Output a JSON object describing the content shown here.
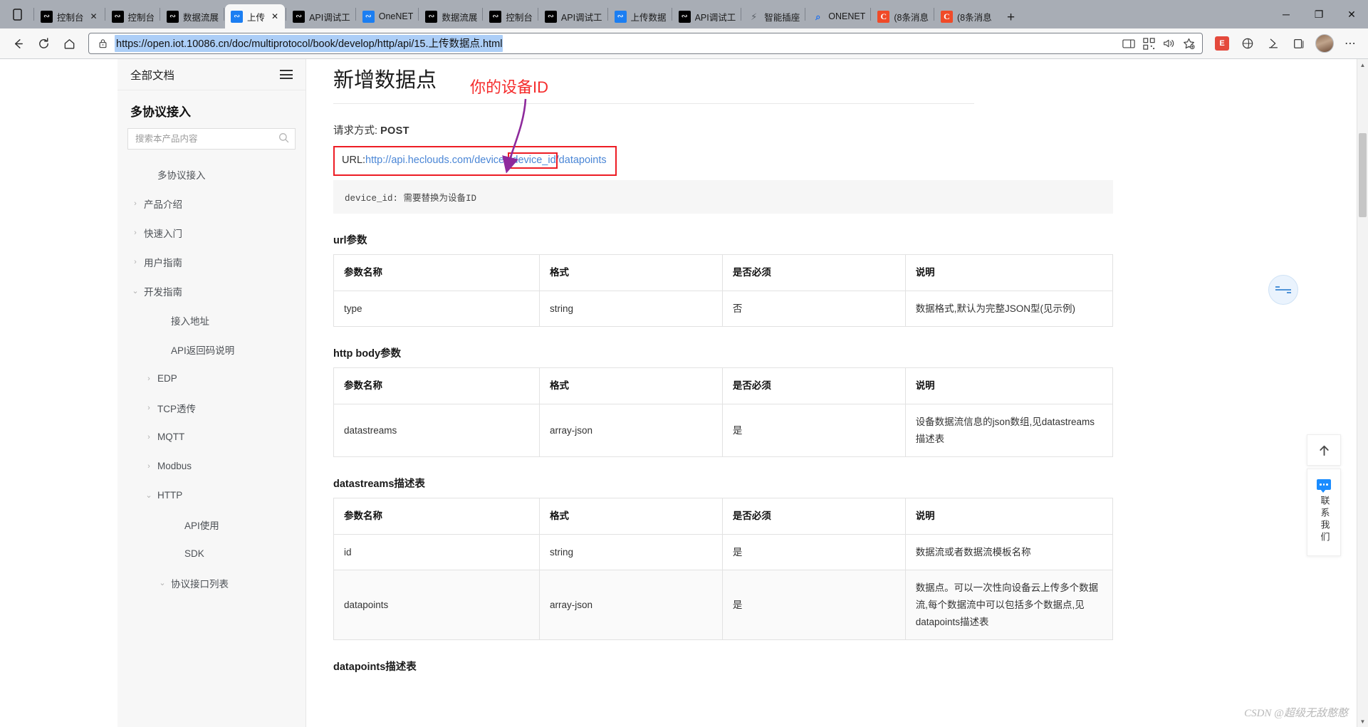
{
  "browser": {
    "tabs": [
      {
        "title": "控制台",
        "favicon": "onenet-icon",
        "active": false,
        "closable": true
      },
      {
        "title": "控制台",
        "favicon": "onenet-icon",
        "active": false,
        "closable": false
      },
      {
        "title": "数据流展",
        "favicon": "onenet-icon",
        "active": false,
        "closable": false
      },
      {
        "title": "上传",
        "favicon": "onenet-blue-icon",
        "active": true,
        "closable": true
      },
      {
        "title": "API调试工",
        "favicon": "onenet-icon",
        "active": false,
        "closable": false
      },
      {
        "title": "OneNET",
        "favicon": "onenet-blue-icon",
        "active": false,
        "closable": false
      },
      {
        "title": "数据流展",
        "favicon": "onenet-icon",
        "active": false,
        "closable": false
      },
      {
        "title": "控制台",
        "favicon": "onenet-icon",
        "active": false,
        "closable": false
      },
      {
        "title": "API调试工",
        "favicon": "onenet-icon",
        "active": false,
        "closable": false
      },
      {
        "title": "上传数据",
        "favicon": "onenet-blue-icon",
        "active": false,
        "closable": false
      },
      {
        "title": "API调试工",
        "favicon": "onenet-icon",
        "active": false,
        "closable": false
      },
      {
        "title": "智能插座",
        "favicon": "plug-icon",
        "active": false,
        "closable": false
      },
      {
        "title": "ONENET",
        "favicon": "search-icon",
        "active": false,
        "closable": false
      },
      {
        "title": "(8条消息",
        "favicon": "csdn-icon",
        "active": false,
        "closable": false
      },
      {
        "title": "(8条消息",
        "favicon": "csdn-icon",
        "active": false,
        "closable": false
      }
    ],
    "new_tab_label": "+",
    "window_controls": {
      "minimize": "─",
      "maximize": "❐",
      "close": "✕"
    },
    "toolbar": {
      "back": "←",
      "reload": "↻",
      "home": "⌂",
      "lock_icon": "lock-icon",
      "url": "https://open.iot.10086.cn/doc/multiprotocol/book/develop/http/api/15.上传数据点.html",
      "split_screen": "split-screen-icon",
      "qr": "qr-code-icon",
      "read_aloud": "read-aloud-icon",
      "favorite": "star-icon",
      "extension": "E",
      "collections": "collections-icon",
      "favorites_bar": "favorites-icon",
      "settings": "⋯"
    }
  },
  "sidebar": {
    "all_docs_label": "全部文档",
    "menu_icon": "hamburger-icon",
    "product_title": "多协议接入",
    "search": {
      "placeholder": "搜索本产品内容",
      "value": "",
      "icon": "search-icon"
    },
    "items": [
      {
        "label": "多协议接入",
        "level": 2,
        "caret": ""
      },
      {
        "label": "产品介绍",
        "level": 1,
        "caret": "›"
      },
      {
        "label": "快速入门",
        "level": 1,
        "caret": "›"
      },
      {
        "label": "用户指南",
        "level": 1,
        "caret": "›"
      },
      {
        "label": "开发指南",
        "level": 1,
        "caret": "⌄"
      },
      {
        "label": "接入地址",
        "level": 3,
        "caret": ""
      },
      {
        "label": "API返回码说明",
        "level": 3,
        "caret": ""
      },
      {
        "label": "EDP",
        "level": 2,
        "caret": "›"
      },
      {
        "label": "TCP透传",
        "level": 2,
        "caret": "›"
      },
      {
        "label": "MQTT",
        "level": 2,
        "caret": "›"
      },
      {
        "label": "Modbus",
        "level": 2,
        "caret": "›"
      },
      {
        "label": "HTTP",
        "level": 2,
        "caret": "⌄"
      },
      {
        "label": "API使用",
        "level": 4,
        "caret": ""
      },
      {
        "label": "SDK",
        "level": 4,
        "caret": ""
      },
      {
        "label": "协议接口列表",
        "level": 3,
        "caret": "⌄"
      }
    ]
  },
  "doc": {
    "title": "新增数据点",
    "request_method_label": "请求方式:",
    "request_method_value": "POST",
    "url_prefix": "URL:",
    "url_base": "http://api.heclouds.com/devices",
    "url_param": "/device_id",
    "url_suffix": "/datapoints",
    "code_note": "device_id: 需要替换为设备ID",
    "annotation": "你的设备ID",
    "annotation_color": "#f52c2c",
    "highlight_color": "#ed1c24",
    "arrow_color": "#8e2a9c",
    "sections": [
      {
        "heading": "url参数",
        "columns": [
          "参数名称",
          "格式",
          "是否必须",
          "说明"
        ],
        "rows": [
          [
            "type",
            "string",
            "否",
            "数据格式,默认为完整JSON型(见示例)"
          ]
        ]
      },
      {
        "heading": "http body参数",
        "columns": [
          "参数名称",
          "格式",
          "是否必须",
          "说明"
        ],
        "rows": [
          [
            "datastreams",
            "array-json",
            "是",
            "设备数据流信息的json数组,见datastreams描述表"
          ]
        ]
      },
      {
        "heading": "datastreams描述表",
        "columns": [
          "参数名称",
          "格式",
          "是否必须",
          "说明"
        ],
        "rows": [
          [
            "id",
            "string",
            "是",
            "数据流或者数据流模板名称"
          ],
          [
            "datapoints",
            "array-json",
            "是",
            "数据点。可以一次性向设备云上传多个数据流,每个数据流中可以包括多个数据点,见datapoints描述表"
          ]
        ]
      },
      {
        "heading": "datapoints描述表",
        "columns": [],
        "rows": []
      }
    ]
  },
  "widgets": {
    "toggle_icon": "collapse-toggle-icon",
    "back_to_top_icon": "arrow-up-icon",
    "contact_icon": "chat-bubble-icon",
    "contact_label": "联系我们"
  },
  "watermark": "CSDN @超级无敌憨憨"
}
